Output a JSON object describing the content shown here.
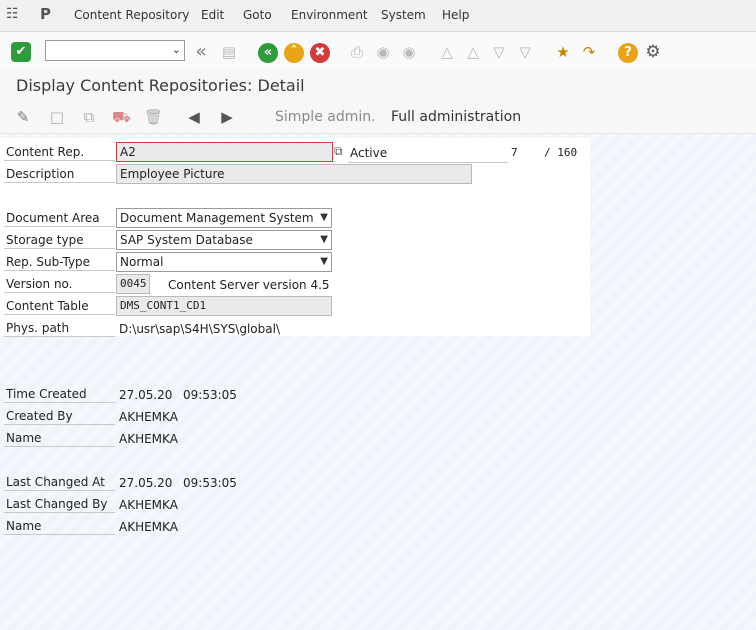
{
  "menu": {
    "items": [
      "Content Repository",
      "Edit",
      "Goto",
      "Environment",
      "System",
      "Help"
    ]
  },
  "toolbar": {
    "command_field_value": ""
  },
  "title": "Display Content Repositories: Detail",
  "app_toolbar": {
    "simple_admin": "Simple admin.",
    "full_admin": "Full administration"
  },
  "form": {
    "content_rep_label": "Content Rep.",
    "content_rep_value": "A2",
    "status": "Active",
    "page_current": "7",
    "page_total": "/ 160",
    "description_label": "Description",
    "description_value": "Employee Picture",
    "document_area_label": "Document Area",
    "document_area_value": "Document Management System",
    "storage_type_label": "Storage type",
    "storage_type_value": "SAP System Database",
    "rep_subtype_label": "Rep. Sub-Type",
    "rep_subtype_value": "Normal",
    "version_label": "Version no.",
    "version_value": "0045",
    "version_text": "Content Server version 4.5",
    "content_table_label": "Content Table",
    "content_table_value": "DMS_CONT1_CD1",
    "phys_path_label": "Phys. path",
    "phys_path_value": "D:\\usr\\sap\\S4H\\SYS\\global\\"
  },
  "admin": {
    "time_created_label": "Time Created",
    "time_created_date": "27.05.20",
    "time_created_time": "09:53:05",
    "created_by_label": "Created By",
    "created_by_value": "AKHEMKA",
    "name1_label": "Name",
    "name1_value": "AKHEMKA",
    "last_changed_at_label": "Last Changed At",
    "last_changed_date": "27.05.20",
    "last_changed_time": "09:53:05",
    "last_changed_by_label": "Last Changed By",
    "last_changed_by_value": "AKHEMKA",
    "name2_label": "Name",
    "name2_value": "AKHEMKA"
  },
  "colors": {
    "enter_green": "#2e9c3a",
    "back_green": "#2e9c3a",
    "exit_orange": "#e8a317",
    "cancel_red": "#d43a3a",
    "help_orange": "#e8a317",
    "nav_arrow": "#555555"
  }
}
